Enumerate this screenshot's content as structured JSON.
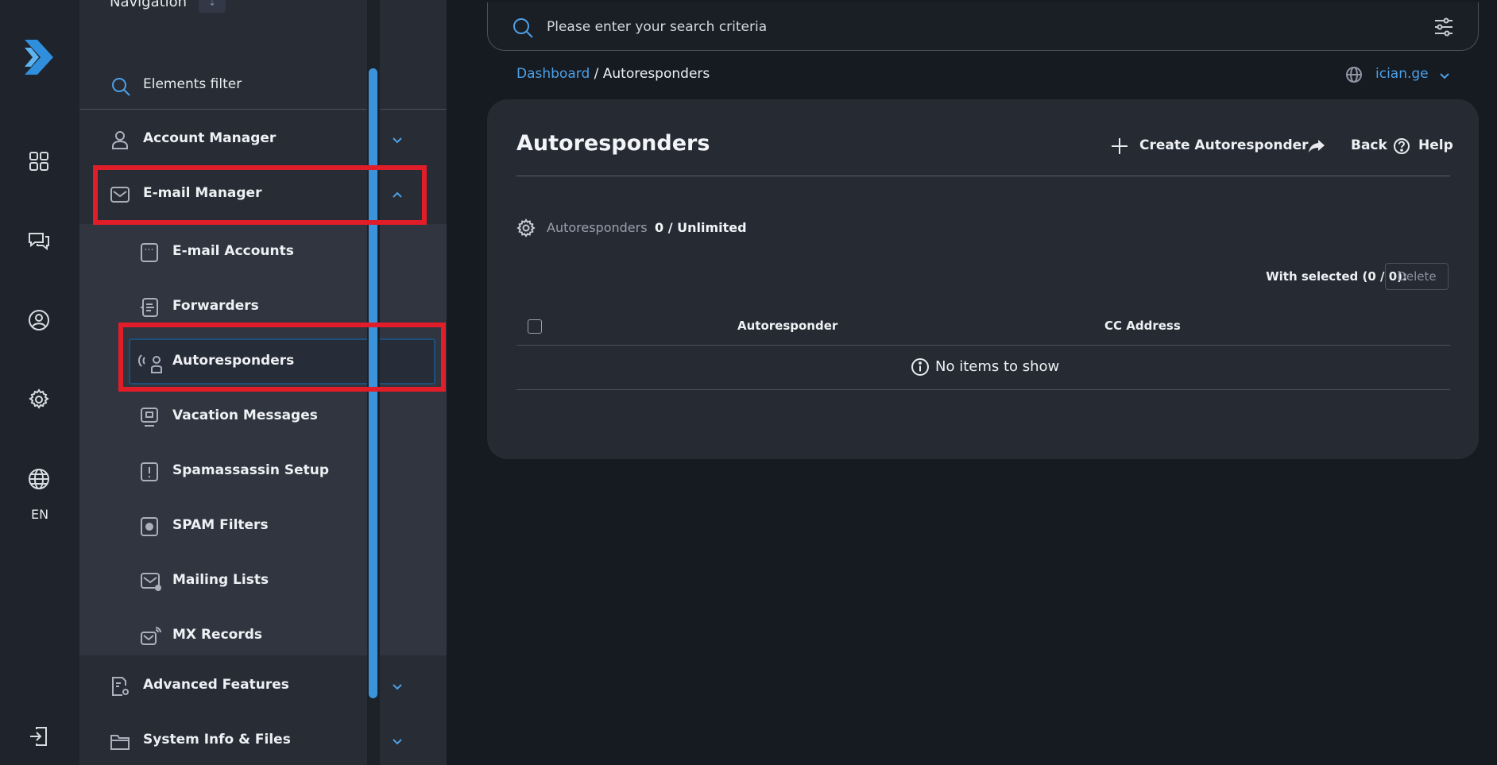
{
  "rail": {
    "logo": "chevron-logo",
    "items": [
      "dashboard-icon",
      "chat-icon",
      "user-circle-icon",
      "gear-icon",
      "globe-icon",
      "logout-icon"
    ],
    "language": "EN"
  },
  "nav": {
    "title": "Navigation",
    "filter_label": "Elements filter",
    "account_manager": "Account Manager",
    "email_manager": "E-mail Manager",
    "sub_items": [
      {
        "label": "E-mail Accounts",
        "icon": "email-accounts-icon"
      },
      {
        "label": "Forwarders",
        "icon": "forwarders-icon"
      },
      {
        "label": "Autoresponders",
        "icon": "autoresponder-icon"
      },
      {
        "label": "Vacation Messages",
        "icon": "vacation-icon"
      },
      {
        "label": "Spamassassin Setup",
        "icon": "spamassassin-icon"
      },
      {
        "label": "SPAM Filters",
        "icon": "spam-filter-icon"
      },
      {
        "label": "Mailing Lists",
        "icon": "mailing-list-icon"
      },
      {
        "label": "MX Records",
        "icon": "mx-records-icon"
      }
    ],
    "advanced_features": "Advanced Features",
    "system_info": "System Info & Files"
  },
  "search": {
    "placeholder": "Please enter your search criteria"
  },
  "breadcrumb": {
    "root": "Dashboard",
    "separator": "/",
    "current": "Autoresponders"
  },
  "domain": {
    "name": "ician.ge"
  },
  "page": {
    "title": "Autoresponders",
    "create_label": "Create Autoresponder",
    "back_label": "Back",
    "help_label": "Help",
    "quota_label": "Autoresponders",
    "quota_value": "0 / Unlimited",
    "with_selected": "With selected (0 / 0):",
    "delete_label": "Delete",
    "columns": [
      "Autoresponder",
      "CC Address"
    ],
    "empty_text": "No items to show"
  },
  "colors": {
    "accent": "#4da0e6",
    "highlight": "#e11d2a",
    "background": "#161a21",
    "card": "#262a33"
  }
}
